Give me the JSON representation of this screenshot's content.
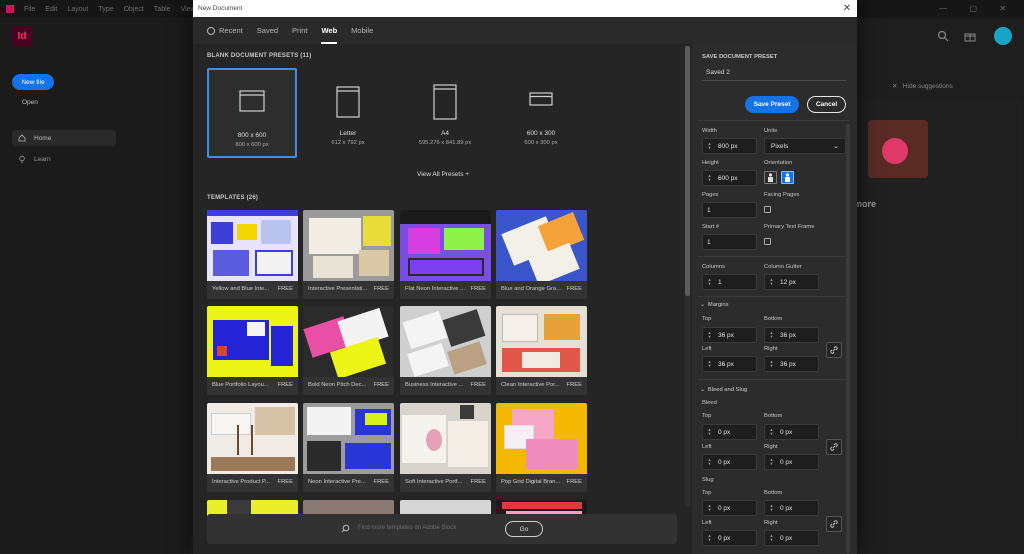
{
  "app": {
    "menu": [
      "File",
      "Edit",
      "Layout",
      "Type",
      "Object",
      "Table",
      "View"
    ],
    "new_file": "New file",
    "open": "Open",
    "nav_home": "Home",
    "nav_learn": "Learn",
    "hide_suggestions": "Hide suggestions",
    "more_text": "d more",
    "logo_text": "Id"
  },
  "dialog": {
    "title": "New Document",
    "tabs": [
      "Recent",
      "Saved",
      "Print",
      "Web",
      "Mobile"
    ],
    "presets_header": "BLANK DOCUMENT PRESETS",
    "presets_count": "(11)",
    "presets": [
      {
        "name": "800 x 600",
        "dim": "800 x 600 px"
      },
      {
        "name": "Letter",
        "dim": "612 x 792 px"
      },
      {
        "name": "A4",
        "dim": "595.276 x 841.89 px"
      },
      {
        "name": "600 x 300",
        "dim": "600 x 300 px"
      }
    ],
    "view_all": "View All Presets +",
    "templates_header": "TEMPLATES",
    "templates_count": "(26)",
    "templates": [
      {
        "label": "Yellow and Blue Inte...",
        "free": "FREE"
      },
      {
        "label": "Interactive Presentati...",
        "free": "FREE"
      },
      {
        "label": "Flat Neon Interactive ...",
        "free": "FREE"
      },
      {
        "label": "Blue and Orange Gra...",
        "free": "FREE"
      },
      {
        "label": "Blue Portfolio Layou...",
        "free": "FREE"
      },
      {
        "label": "Bold Neon Pitch Dec...",
        "free": "FREE"
      },
      {
        "label": "Business Interactive ...",
        "free": "FREE"
      },
      {
        "label": "Clean Interactive Por...",
        "free": "FREE"
      },
      {
        "label": "Interactive Product P...",
        "free": "FREE"
      },
      {
        "label": "Neon Interactive Pre...",
        "free": "FREE"
      },
      {
        "label": "Soft Interactive Portf...",
        "free": "FREE"
      },
      {
        "label": "Pop Grid Digital Bran...",
        "free": "FREE"
      }
    ],
    "search_placeholder": "Find more templates on Adobe Stock",
    "go": "Go"
  },
  "details": {
    "save_preset_header": "SAVE DOCUMENT PRESET",
    "preset_name": "Saved 2",
    "save_button": "Save Preset",
    "cancel_button": "Cancel",
    "width_label": "Width",
    "width_value": "800 px",
    "units_label": "Units",
    "units_value": "Pixels",
    "height_label": "Height",
    "height_value": "600 px",
    "orientation_label": "Orientation",
    "pages_label": "Pages",
    "pages_value": "1",
    "facing_pages_label": "Facing Pages",
    "start_label": "Start #",
    "start_value": "1",
    "primary_text_frame_label": "Primary Text Frame",
    "columns_label": "Columns",
    "columns_value": "1",
    "column_gutter_label": "Column Gutter",
    "column_gutter_value": "12 px",
    "margins_label": "Margins",
    "margin_top_label": "Top",
    "margin_top": "36 px",
    "margin_bottom_label": "Bottom",
    "margin_bottom": "36 px",
    "margin_left_label": "Left",
    "margin_left": "36 px",
    "margin_right_label": "Right",
    "margin_right": "36 px",
    "bleed_slug_label": "Bleed and Slug",
    "bleed_label": "Bleed",
    "bleed_top_label": "Top",
    "bleed_top": "0 px",
    "bleed_bottom_label": "Bottom",
    "bleed_bottom": "0 px",
    "bleed_left_label": "Left",
    "bleed_left": "0 px",
    "bleed_right_label": "Right",
    "bleed_right": "0 px",
    "slug_label": "Slug",
    "slug_top_label": "Top",
    "slug_top": "0 px",
    "slug_bottom_label": "Bottom",
    "slug_bottom": "0 px",
    "slug_left_label": "Left",
    "slug_left": "0 px",
    "slug_right_label": "Right",
    "slug_right": "0 px"
  },
  "colors": {
    "accent": "#1473e6",
    "selected_border": "#3b8eea",
    "dialog_bg": "#252525",
    "panel_bg": "#2c2c2c"
  }
}
